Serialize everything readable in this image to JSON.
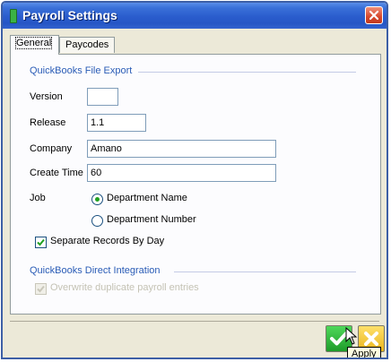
{
  "window": {
    "title": "Payroll Settings"
  },
  "tabs": [
    {
      "label": "General",
      "active": true
    },
    {
      "label": "Paycodes",
      "active": false
    }
  ],
  "export_group": {
    "title": "QuickBooks File Export",
    "fields": {
      "version": {
        "label": "Version",
        "value": ""
      },
      "release": {
        "label": "Release",
        "value": "1.1"
      },
      "company": {
        "label": "Company",
        "value": "Amano"
      },
      "create_time": {
        "label": "Create Time",
        "value": "60"
      }
    },
    "job": {
      "label": "Job",
      "options": [
        {
          "label": "Department Name",
          "selected": true
        },
        {
          "label": "Department Number",
          "selected": false
        }
      ]
    },
    "separate_records": {
      "label": "Separate Records By Day",
      "checked": true
    }
  },
  "direct_group": {
    "title": "QuickBooks Direct Integration",
    "overwrite": {
      "label": "Overwrite duplicate payroll entries",
      "checked": true,
      "enabled": false
    }
  },
  "buttons": {
    "ok_tooltip": "Apply"
  },
  "icons": {
    "close": "close-icon",
    "ok": "checkmark-icon",
    "cancel": "x-icon",
    "cursor": "mouse-cursor-icon"
  },
  "colors": {
    "title_bar": "#2a5ccd",
    "group_title": "#2a5cb6",
    "ok_green": "#2ab534",
    "cancel_yellow": "#f0c020"
  }
}
